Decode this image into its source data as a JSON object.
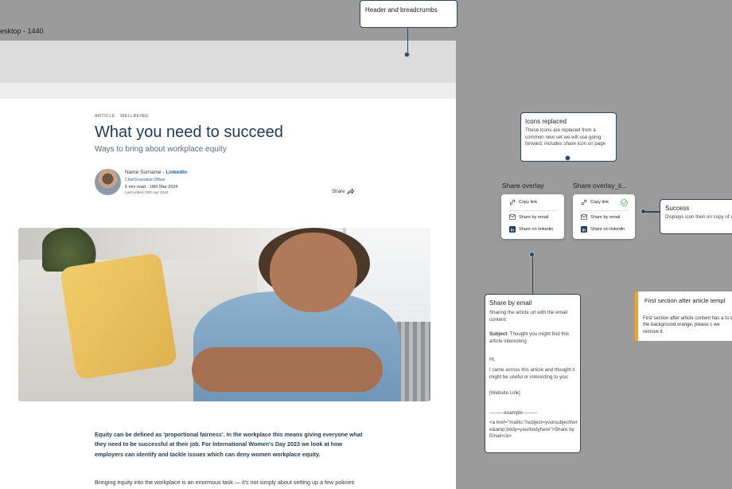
{
  "canvas": {
    "frame_label": "esktop - 1440"
  },
  "article": {
    "eyebrow": "ARTICLE · WELLBEING",
    "title": "What you need to succeed",
    "subtitle": "Ways to bring about workplace equity",
    "author": {
      "name": "Name Surname",
      "separator": " - ",
      "link": "LinkedIn",
      "role": "Chief Executive Officer",
      "read_info": "6 min read · 18th Mar 2024",
      "edited": "Last edited 20th Apr 2024"
    },
    "share_label": "Share",
    "intro": "Equity can be defined as 'proportional fairness'. In the workplace this means giving everyone what they need to be successful at their job. For International Women's Day 2023 we look at how employers can identify and tackle issues which can deny women workplace equity.",
    "para2": "Bringing equity into the workplace is an enormous task — it's not simply about setting up a few policies"
  },
  "annotations": {
    "header": {
      "title": "Header and breadcrumbs"
    },
    "icons": {
      "title": "Icons replaced",
      "text": "These icons are replaced from a common new set we will use going forward; includes share icon on page"
    },
    "success": {
      "title": "Success",
      "text": "Displays icon then on copy of clipboard"
    },
    "share_email": {
      "title": "Share by email",
      "intro": "Sharing the article url with the email content:",
      "subject_label": "Subject",
      "subject_text": ": Thought you might find this article interesting",
      "greeting": "Hi,",
      "body": "I came across this article and thought it might be useful or interesting to you:",
      "link": "[Website Link]",
      "example_label": "---------example---------",
      "example_code": "<a href=\"mailto:?subject=yoursubjecthere&amp;body=yourbodyhere\">Share by Email</a>"
    },
    "first_section": {
      "title": "First section after article templ",
      "text": "First section after article content has a to set the background orange, please c we remove it."
    }
  },
  "overlays": {
    "share": {
      "label": "Share overlay",
      "copy": "Copy link",
      "email": "Share by email",
      "linkedin": "Share on linkedin"
    },
    "share_link": {
      "label": "Share overlay_li...",
      "copy": "Copy link",
      "email": "Share by email",
      "linkedin": "Share on linkedin"
    }
  },
  "colors": {
    "accent": "#1e3a5c",
    "link": "#1d5fa0",
    "annotation_border": "#2c4561",
    "success": "#3aa55a",
    "note_accent": "#f3a21c",
    "canvas": "#9b9b9b"
  }
}
